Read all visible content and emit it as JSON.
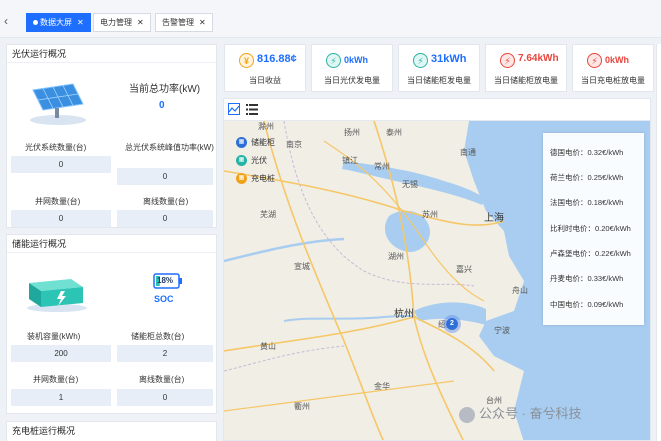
{
  "tabs": [
    {
      "label": "数据大屏",
      "active": true
    },
    {
      "label": "电力管理",
      "active": false
    },
    {
      "label": "告警管理",
      "active": false
    }
  ],
  "pv": {
    "title": "光伏运行概况",
    "power_label": "当前总功率(kW)",
    "power_value": "0",
    "count_label": "光伏系统数量(台)",
    "count_value": "0",
    "peak_label": "总光伏系统峰值功率(kW)",
    "peak_value": "0",
    "online_label": "并网数量(台)",
    "online_value": "0",
    "offline_label": "离线数量(台)",
    "offline_value": "0"
  },
  "storage": {
    "title": "储能运行概况",
    "soc_value": "18%",
    "soc_label": "SOC",
    "soc_fraction": 0.18,
    "capacity_label": "装机容量(kWh)",
    "capacity_value": "200",
    "cabinet_label": "储能柜总数(台)",
    "cabinet_value": "2",
    "online_label": "并网数量(台)",
    "online_value": "1",
    "offline_label": "离线数量(台)",
    "offline_value": "0"
  },
  "charging": {
    "title": "充电桩运行概况"
  },
  "stats": [
    {
      "value": "816.88¢",
      "label": "当日收益",
      "icon": "yen-icon",
      "glyph": "¥",
      "color": "#f0a21a"
    },
    {
      "value": "0kWh",
      "label": "当日光伏发电量",
      "icon": "solar-power-icon",
      "glyph": "⚡",
      "color": "#27b3a5"
    },
    {
      "value": "31kWh",
      "label": "当日储能柜发电量",
      "icon": "storage-power-icon",
      "glyph": "⚡",
      "color": "#27b3a5"
    },
    {
      "value": "7.64kWh",
      "label": "当日储能柜放电量",
      "icon": "discharge-icon",
      "glyph": "⚡",
      "color": "#e8453c"
    },
    {
      "value": "0kWh",
      "label": "当日充电桩放电量",
      "icon": "charging-icon",
      "glyph": "⚡",
      "color": "#e8453c"
    }
  ],
  "map": {
    "legend": [
      {
        "label": "储能柜",
        "color": "#2f6fd8"
      },
      {
        "label": "光伏",
        "color": "#27b3a5"
      },
      {
        "label": "充电桩",
        "color": "#f0a21a"
      }
    ],
    "cities": {
      "nanjing": "南京",
      "changzhou": "常州",
      "wuxi": "无锡",
      "suzhou": "苏州",
      "shanghai": "上海",
      "jiaxing": "嘉兴",
      "huzhou": "湖州",
      "hangzhou": "杭州",
      "shaoxing": "绍兴",
      "ningbo": "宁波",
      "zhoushan": "舟山",
      "wuhu": "芜湖",
      "xuancheng": "宣城",
      "chuzhou": "滁州",
      "taizhou_js": "泰州",
      "nantong": "南通",
      "yangzhou": "扬州",
      "zhenjiang": "镇江",
      "huangshan": "黄山",
      "jinhua": "金华",
      "quzhou": "衢州",
      "taizhou_zj": "台州"
    },
    "prices": [
      "德国电价：0.32€/kWh",
      "荷兰电价：0.25€/kWh",
      "法国电价：0.18€/kWh",
      "比利时电价：0.20€/kWh",
      "卢森堡电价：0.22€/kWh",
      "丹麦电价：0.33€/kWh",
      "中国电价：0.09€/kWh"
    ],
    "cluster_count": "2"
  },
  "watermark": "公众号 · 奋兮科技"
}
